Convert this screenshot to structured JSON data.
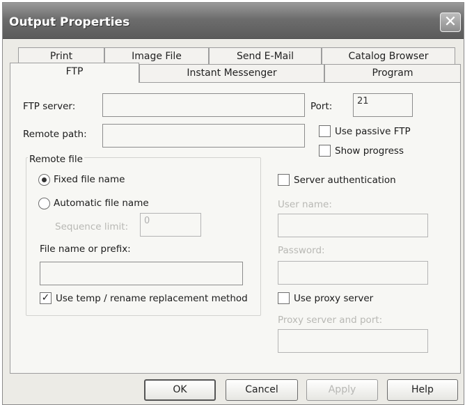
{
  "window": {
    "title": "Output Properties",
    "close_glyph": "✕"
  },
  "tabs": {
    "row1": [
      "Print",
      "Image File",
      "Send E-Mail",
      "Catalog Browser"
    ],
    "row2": [
      "FTP",
      "Instant Messenger",
      "Program"
    ],
    "active": "FTP"
  },
  "ftp": {
    "server_label": "FTP server:",
    "server_value": "",
    "port_label": "Port:",
    "port_value": "21",
    "remote_path_label": "Remote path:",
    "remote_path_value": "",
    "passive_label": "Use passive FTP",
    "passive_checked": false,
    "progress_label": "Show progress",
    "progress_checked": false
  },
  "remote_file": {
    "group_label": "Remote file",
    "fixed_label": "Fixed file name",
    "fixed_selected": true,
    "auto_label": "Automatic file name",
    "auto_selected": false,
    "sequence_label": "Sequence limit:",
    "sequence_value": "0",
    "prefix_label": "File name or prefix:",
    "prefix_value": "",
    "temp_label": "Use temp / rename replacement method",
    "temp_checked": true,
    "check_glyph": "✓"
  },
  "auth": {
    "server_auth_label": "Server authentication",
    "server_auth_checked": false,
    "username_label": "User name:",
    "username_value": "",
    "password_label": "Password:",
    "password_value": "",
    "proxy_label": "Use proxy server",
    "proxy_checked": false,
    "proxy_server_label": "Proxy server and port:",
    "proxy_server_value": ""
  },
  "buttons": {
    "ok": "OK",
    "cancel": "Cancel",
    "apply": "Apply",
    "help": "Help"
  }
}
